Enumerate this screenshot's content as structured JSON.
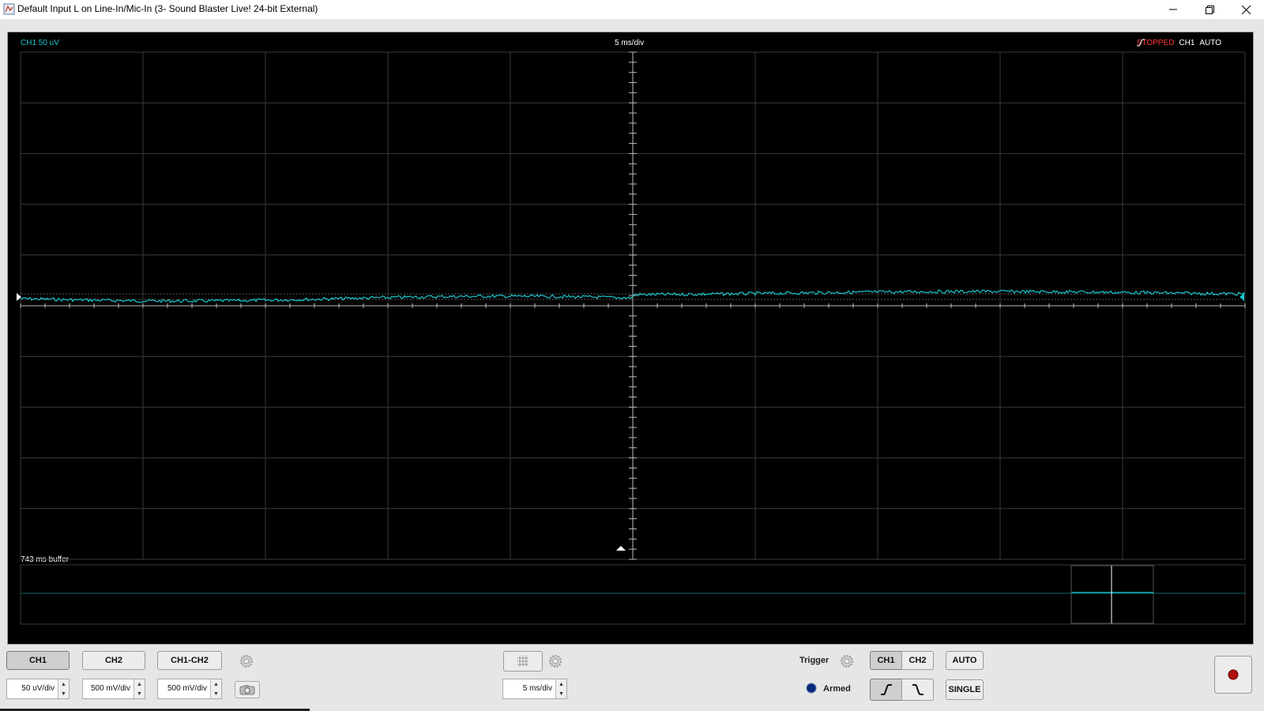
{
  "window": {
    "title": "Default Input L on Line-In/Mic-In (3- Sound Blaster Live! 24-bit External)",
    "controls": [
      "minimize-icon",
      "restore-icon",
      "close-icon"
    ]
  },
  "scope": {
    "channel_scale_label": "CH1 50 uV",
    "timebase_label": "5 ms/div",
    "status": {
      "state": "STOPPED",
      "trigger_channel": "CH1",
      "trigger_slope_icon": "rising-edge-icon",
      "mode": "AUTO"
    },
    "buffer_label": "743 ms buffer",
    "colors": {
      "background": "#000000",
      "grid": "#3a3a3a",
      "trace": "#19c6cf",
      "stopped": "#ff3b3b",
      "text": "#ffffff",
      "ch_label": "#19c6cf"
    }
  },
  "controls": {
    "channels": [
      {
        "label": "CH1",
        "scale": "50 uV/div",
        "active": true
      },
      {
        "label": "CH2",
        "scale": "500 mV/div",
        "active": false
      },
      {
        "label": "CH1-CH2",
        "scale": "500 mV/div",
        "active": false
      }
    ],
    "snapshot_icon": "camera-icon",
    "channel_settings_icon": "gear-icon",
    "timebase": {
      "scale": "5 ms/div",
      "grid_icon": "grid-icon",
      "settings_icon": "gear-icon"
    },
    "trigger": {
      "label": "Trigger",
      "settings_icon": "gear-icon",
      "channels": [
        "CH1",
        "CH2"
      ],
      "active_channel": "CH1",
      "mode_button": "AUTO",
      "single_button": "SINGLE",
      "armed_label": "Armed",
      "slopes": [
        "rising-edge-icon",
        "falling-edge-icon"
      ],
      "active_slope": "rising"
    },
    "record_icon": "record-icon"
  }
}
